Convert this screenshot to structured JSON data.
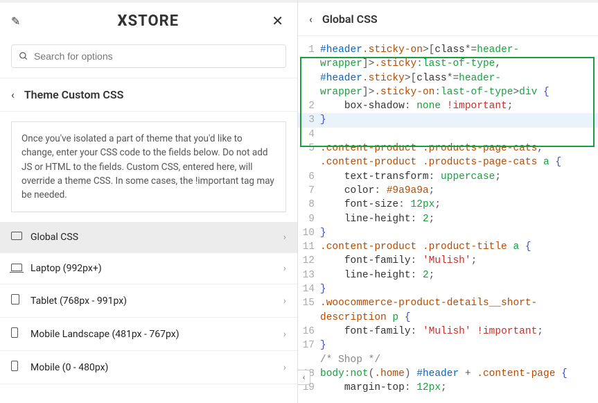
{
  "logo_prefix": "X",
  "logo_text": "STORE",
  "search_placeholder": "Search for options",
  "section_title": "Theme Custom CSS",
  "help_text": "Once you've isolated a part of theme that you'd like to change, enter your CSS code to the fields below. Do not add JS or HTML to the fields. Custom CSS, entered here, will override a theme CSS. In some cases, the !important tag may be needed.",
  "menu": [
    {
      "label": "Global CSS",
      "icon": "desktop",
      "active": true
    },
    {
      "label": "Laptop (992px+)",
      "icon": "laptop",
      "active": false
    },
    {
      "label": "Tablet (768px - 991px)",
      "icon": "tablet",
      "active": false
    },
    {
      "label": "Mobile Landscape (481px - 767px)",
      "icon": "mobile",
      "active": false
    },
    {
      "label": "Mobile (0 - 480px)",
      "icon": "mobile",
      "active": false
    }
  ],
  "right_title": "Global CSS",
  "code_lines": [
    {
      "n": 1,
      "tokens": [
        [
          "id",
          "#header"
        ],
        [
          "cls",
          ".sticky-on"
        ],
        [
          "punc",
          ">"
        ],
        [
          "punc",
          "["
        ],
        [
          "prop",
          "class"
        ],
        [
          "punc",
          "*="
        ],
        [
          "val",
          "header-"
        ]
      ]
    },
    {
      "n": "",
      "tokens": [
        [
          "val",
          "wrapper"
        ],
        [
          "punc",
          "]"
        ],
        [
          "punc",
          ">"
        ],
        [
          "cls",
          ".sticky"
        ],
        [
          "pseudo",
          ":last-of-type"
        ],
        [
          "punc",
          ", "
        ]
      ]
    },
    {
      "n": "",
      "tokens": [
        [
          "id",
          "#header"
        ],
        [
          "cls",
          ".sticky"
        ],
        [
          "punc",
          ">"
        ],
        [
          "punc",
          "["
        ],
        [
          "prop",
          "class"
        ],
        [
          "punc",
          "*="
        ],
        [
          "val",
          "header-"
        ]
      ]
    },
    {
      "n": "",
      "tokens": [
        [
          "val",
          "wrapper"
        ],
        [
          "punc",
          "]"
        ],
        [
          "punc",
          ">"
        ],
        [
          "cls",
          ".sticky-on"
        ],
        [
          "pseudo",
          ":last-of-type"
        ],
        [
          "punc",
          ">"
        ],
        [
          "tag",
          "div"
        ],
        [
          "punc",
          " "
        ],
        [
          "brace",
          "{"
        ]
      ]
    },
    {
      "n": 2,
      "tokens": [
        [
          "plain",
          "    "
        ],
        [
          "prop",
          "box-shadow"
        ],
        [
          "punc",
          ": "
        ],
        [
          "val",
          "none"
        ],
        [
          "punc",
          " "
        ],
        [
          "imp",
          "!important"
        ],
        [
          "punc",
          ";"
        ]
      ]
    },
    {
      "n": 3,
      "hl": true,
      "tokens": [
        [
          "brace",
          "}"
        ]
      ]
    },
    {
      "n": 4,
      "tokens": []
    },
    {
      "n": 5,
      "tokens": [
        [
          "cls",
          ".content-product"
        ],
        [
          "punc",
          " "
        ],
        [
          "cls",
          ".products-page-cats"
        ],
        [
          "punc",
          ", "
        ]
      ]
    },
    {
      "n": "",
      "tokens": [
        [
          "cls",
          ".content-product"
        ],
        [
          "punc",
          " "
        ],
        [
          "cls",
          ".products-page-cats"
        ],
        [
          "punc",
          " "
        ],
        [
          "tag",
          "a"
        ],
        [
          "punc",
          " "
        ],
        [
          "brace",
          "{"
        ]
      ]
    },
    {
      "n": 6,
      "tokens": [
        [
          "plain",
          "    "
        ],
        [
          "prop",
          "text-transform"
        ],
        [
          "punc",
          ": "
        ],
        [
          "val",
          "uppercase"
        ],
        [
          "punc",
          ";"
        ]
      ]
    },
    {
      "n": 7,
      "tokens": [
        [
          "plain",
          "    "
        ],
        [
          "prop",
          "color"
        ],
        [
          "punc",
          ": "
        ],
        [
          "hex",
          "#9a9a9a"
        ],
        [
          "punc",
          ";"
        ]
      ]
    },
    {
      "n": 8,
      "tokens": [
        [
          "plain",
          "    "
        ],
        [
          "prop",
          "font-size"
        ],
        [
          "punc",
          ": "
        ],
        [
          "val",
          "12px"
        ],
        [
          "punc",
          ";"
        ]
      ]
    },
    {
      "n": 9,
      "tokens": [
        [
          "plain",
          "    "
        ],
        [
          "prop",
          "line-height"
        ],
        [
          "punc",
          ": "
        ],
        [
          "val",
          "2"
        ],
        [
          "punc",
          ";"
        ]
      ]
    },
    {
      "n": 10,
      "tokens": [
        [
          "brace",
          "}"
        ]
      ]
    },
    {
      "n": 11,
      "tokens": [
        [
          "cls",
          ".content-product"
        ],
        [
          "punc",
          " "
        ],
        [
          "cls",
          ".product-title"
        ],
        [
          "punc",
          " "
        ],
        [
          "tag",
          "a"
        ],
        [
          "punc",
          " "
        ],
        [
          "brace",
          "{"
        ]
      ]
    },
    {
      "n": 12,
      "tokens": [
        [
          "plain",
          "    "
        ],
        [
          "prop",
          "font-family"
        ],
        [
          "punc",
          ": "
        ],
        [
          "str",
          "'Mulish'"
        ],
        [
          "punc",
          ";"
        ]
      ]
    },
    {
      "n": 13,
      "tokens": [
        [
          "plain",
          "    "
        ],
        [
          "prop",
          "line-height"
        ],
        [
          "punc",
          ": "
        ],
        [
          "val",
          "2"
        ],
        [
          "punc",
          ";"
        ]
      ]
    },
    {
      "n": 14,
      "tokens": [
        [
          "brace",
          "}"
        ]
      ]
    },
    {
      "n": 15,
      "tokens": [
        [
          "cls",
          ".woocommerce-product-details__short-"
        ]
      ]
    },
    {
      "n": "",
      "tokens": [
        [
          "cls",
          "description"
        ],
        [
          "punc",
          " "
        ],
        [
          "tag",
          "p"
        ],
        [
          "punc",
          " "
        ],
        [
          "brace",
          "{"
        ]
      ]
    },
    {
      "n": 16,
      "tokens": [
        [
          "plain",
          "    "
        ],
        [
          "prop",
          "font-family"
        ],
        [
          "punc",
          ": "
        ],
        [
          "str",
          "'Mulish'"
        ],
        [
          "punc",
          " "
        ],
        [
          "imp",
          "!important"
        ],
        [
          "punc",
          ";"
        ]
      ]
    },
    {
      "n": 17,
      "tokens": [
        [
          "brace",
          "}"
        ]
      ]
    },
    {
      "n": "",
      "tokens": [
        [
          "com",
          "/* Shop */"
        ]
      ]
    },
    {
      "n": 18,
      "tokens": [
        [
          "tag",
          "body"
        ],
        [
          "pseudo",
          ":not"
        ],
        [
          "punc",
          "("
        ],
        [
          "cls",
          ".home"
        ],
        [
          "punc",
          ")"
        ],
        [
          "punc",
          " "
        ],
        [
          "id",
          "#header"
        ],
        [
          "punc",
          " + "
        ],
        [
          "cls",
          ".content-page"
        ],
        [
          "punc",
          " "
        ],
        [
          "brace",
          "{"
        ]
      ]
    },
    {
      "n": 19,
      "tokens": [
        [
          "plain",
          "    "
        ],
        [
          "prop",
          "margin-top"
        ],
        [
          "punc",
          ": "
        ],
        [
          "val",
          "12px"
        ],
        [
          "punc",
          ";"
        ]
      ]
    }
  ]
}
